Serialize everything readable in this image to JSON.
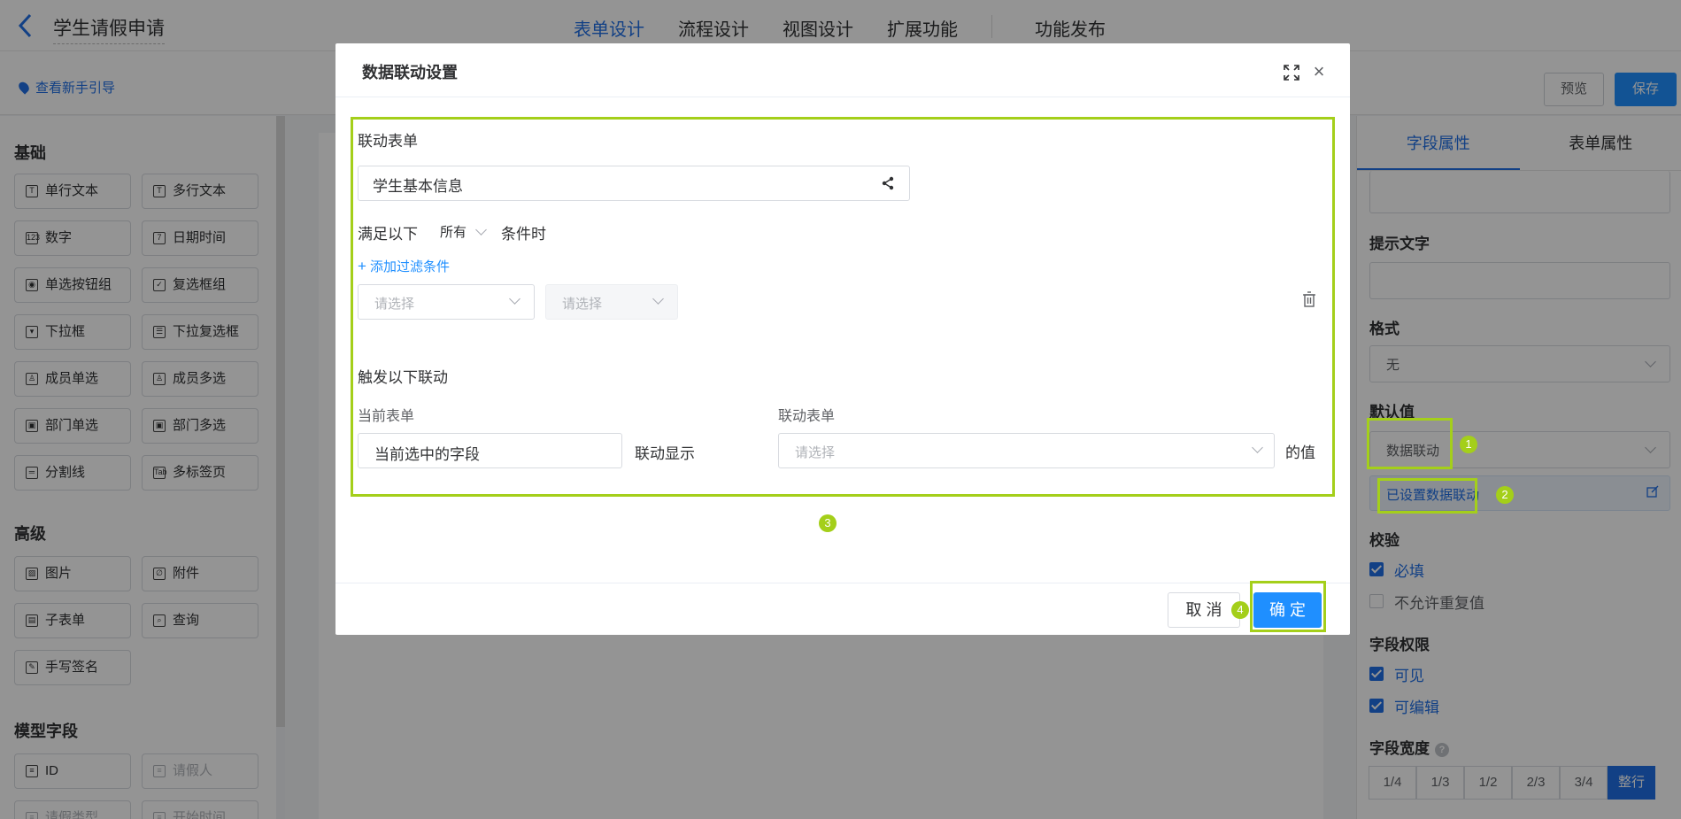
{
  "header": {
    "title": "学生请假申请",
    "tabs": [
      "表单设计",
      "流程设计",
      "视图设计",
      "扩展功能",
      "功能发布"
    ]
  },
  "subbar": {
    "guide": "查看新手引导",
    "preview": "预览",
    "save": "保存"
  },
  "left": {
    "basic_title": "基础",
    "basic": [
      {
        "label": "单行文本",
        "icon": "T"
      },
      {
        "label": "多行文本",
        "icon": "T"
      },
      {
        "label": "数字",
        "icon": "123"
      },
      {
        "label": "日期时间",
        "icon": "7"
      },
      {
        "label": "单选按钮组",
        "icon": "◉"
      },
      {
        "label": "复选框组",
        "icon": "✓"
      },
      {
        "label": "下拉框",
        "icon": "▾"
      },
      {
        "label": "下拉复选框",
        "icon": "☰"
      },
      {
        "label": "成员单选",
        "icon": "♙"
      },
      {
        "label": "成员多选",
        "icon": "♙"
      },
      {
        "label": "部门单选",
        "icon": "▣"
      },
      {
        "label": "部门多选",
        "icon": "▣"
      },
      {
        "label": "分割线",
        "icon": "═"
      },
      {
        "label": "多标签页",
        "icon": "Tab"
      }
    ],
    "advanced_title": "高级",
    "advanced": [
      {
        "label": "图片",
        "icon": "▨"
      },
      {
        "label": "附件",
        "icon": "∅"
      },
      {
        "label": "子表单",
        "icon": "▤"
      },
      {
        "label": "查询",
        "icon": "⌕"
      },
      {
        "label": "手写签名",
        "icon": "✎"
      }
    ],
    "model_title": "模型字段",
    "model": [
      {
        "label": "ID",
        "icon": "≡",
        "disabled": false
      },
      {
        "label": "请假人",
        "icon": "≡",
        "disabled": true
      },
      {
        "label": "请假类型",
        "icon": "≡",
        "disabled": true
      },
      {
        "label": "开始时间",
        "icon": "≡",
        "disabled": true
      }
    ]
  },
  "right": {
    "tab_field": "字段属性",
    "tab_form": "表单属性",
    "hint_label": "提示文字",
    "format_label": "格式",
    "format_value": "无",
    "default_label": "默认值",
    "default_value": "数据联动",
    "linkage_set": "已设置数据联动",
    "validate_label": "校验",
    "required": "必填",
    "no_dup": "不允许重复值",
    "perm_label": "字段权限",
    "visible": "可见",
    "editable": "可编辑",
    "width_label": "字段宽度",
    "widths": [
      "1/4",
      "1/3",
      "1/2",
      "2/3",
      "3/4",
      "整行"
    ],
    "width_active": "整行"
  },
  "modal": {
    "title": "数据联动设置",
    "linked_form_label": "联动表单",
    "linked_form_value": "学生基本信息",
    "cond_prefix": "满足以下",
    "cond_mode": "所有",
    "cond_suffix": "条件时",
    "add_filter": "添加过滤条件",
    "filter_ph1": "请选择",
    "filter_ph2": "请选择",
    "trigger_label": "触发以下联动",
    "current_form_label": "当前表单",
    "current_field": "当前选中的字段",
    "link_show": "联动显示",
    "target_form_label": "联动表单",
    "target_ph": "请选择",
    "value_suffix": "的值",
    "cancel": "取 消",
    "ok": "确 定"
  },
  "markers": [
    "1",
    "2",
    "3",
    "4"
  ],
  "colors": {
    "primary": "#1f8fff",
    "highlight": "#a4cf1a"
  }
}
